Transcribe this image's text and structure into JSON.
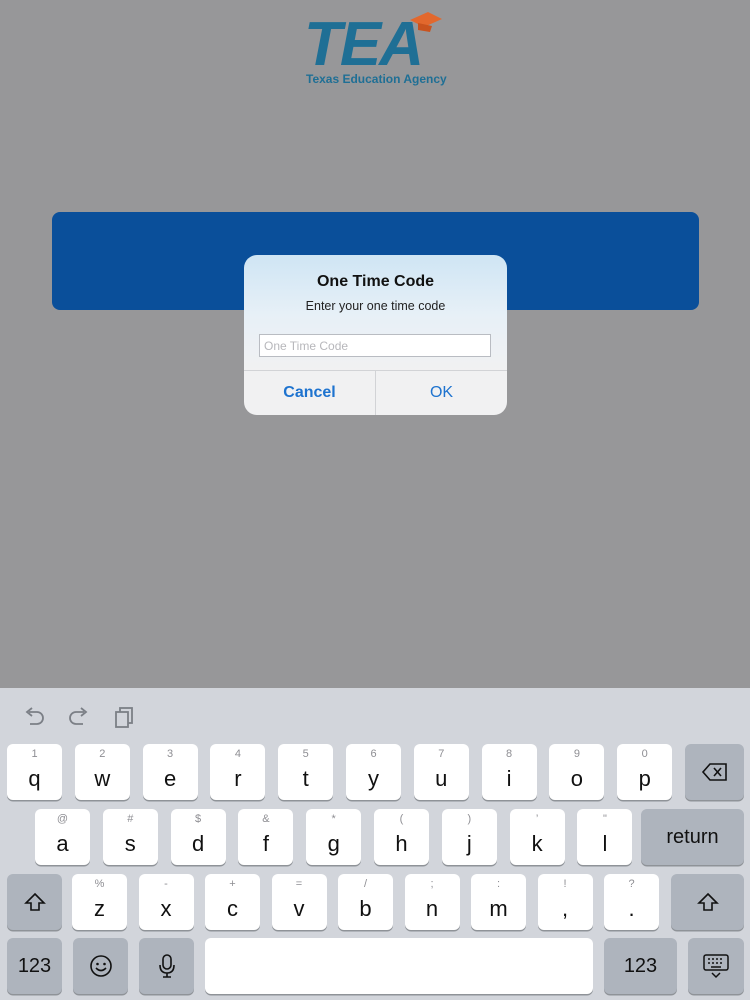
{
  "logo": {
    "wordmark": "TEA",
    "subtitle": "Texas Education Agency"
  },
  "background_button": {
    "label": ""
  },
  "dialog": {
    "title": "One Time Code",
    "message": "Enter your one time code",
    "input_placeholder": "One Time Code",
    "input_value": "",
    "cancel_label": "Cancel",
    "ok_label": "OK"
  },
  "keyboard": {
    "toolbar_icons": [
      "undo-icon",
      "redo-icon",
      "paste-icon"
    ],
    "row1": [
      {
        "hint": "1",
        "main": "q"
      },
      {
        "hint": "2",
        "main": "w"
      },
      {
        "hint": "3",
        "main": "e"
      },
      {
        "hint": "4",
        "main": "r"
      },
      {
        "hint": "5",
        "main": "t"
      },
      {
        "hint": "6",
        "main": "y"
      },
      {
        "hint": "7",
        "main": "u"
      },
      {
        "hint": "8",
        "main": "i"
      },
      {
        "hint": "9",
        "main": "o"
      },
      {
        "hint": "0",
        "main": "p"
      }
    ],
    "row2": [
      {
        "hint": "@",
        "main": "a"
      },
      {
        "hint": "#",
        "main": "s"
      },
      {
        "hint": "$",
        "main": "d"
      },
      {
        "hint": "&",
        "main": "f"
      },
      {
        "hint": "*",
        "main": "g"
      },
      {
        "hint": "(",
        "main": "h"
      },
      {
        "hint": ")",
        "main": "j"
      },
      {
        "hint": "’",
        "main": "k"
      },
      {
        "hint": "\"",
        "main": "l"
      }
    ],
    "row3": [
      {
        "hint": "%",
        "main": "z"
      },
      {
        "hint": "-",
        "main": "x"
      },
      {
        "hint": "+",
        "main": "c"
      },
      {
        "hint": "=",
        "main": "v"
      },
      {
        "hint": "/",
        "main": "b"
      },
      {
        "hint": ";",
        "main": "n"
      },
      {
        "hint": ":",
        "main": "m"
      },
      {
        "hint": "!",
        "main": ","
      },
      {
        "hint": "?",
        "main": "."
      }
    ],
    "return_label": "return",
    "numbers_label": "123",
    "space_label": "",
    "colors": {
      "background": "#d2d5db",
      "key": "#ffffff",
      "special_key": "#aeb4bd",
      "accent": "#1e73cf"
    }
  }
}
